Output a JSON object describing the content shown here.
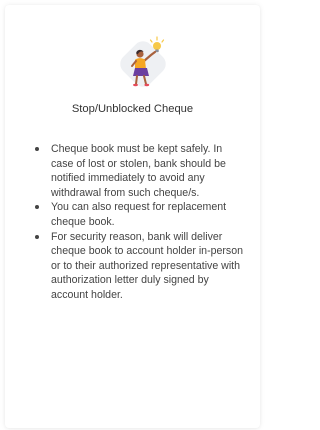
{
  "card": {
    "illustration_icon": "person-holding-lightbulb-illustration",
    "title": "Stop/Unblocked Cheque",
    "points": [
      "Cheque book must be kept safely. In case of lost or stolen, bank should be notified immediately to avoid any withdrawal from such cheque/s.",
      "You can also request for replacement cheque book.",
      "For security reason, bank will deliver cheque book to account holder in-person or to their authorized representative with authorization letter duly signed by account holder."
    ]
  },
  "colors": {
    "illustration_bg": "#eef0f3",
    "accent_purple": "#6b3fa0",
    "accent_orange": "#f5a623",
    "bulb_yellow": "#f7c948",
    "skin": "#a9613d"
  }
}
